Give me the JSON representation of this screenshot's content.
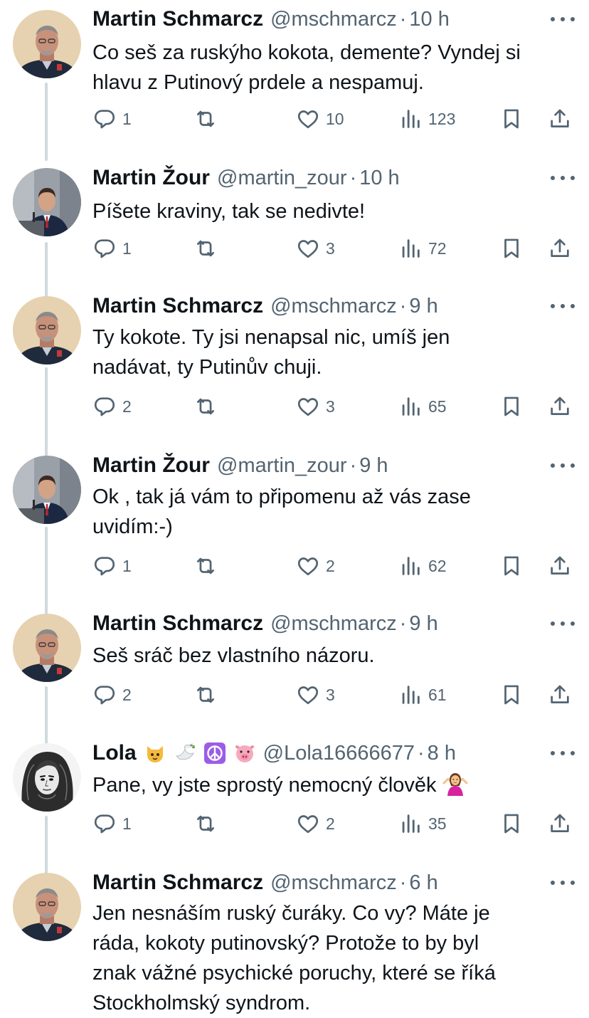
{
  "tweets": [
    {
      "name": "Martin Schmarcz",
      "handle": "@mschmarcz",
      "dot": "·",
      "time": "10 h",
      "lines": [
        "Co seš za ruskýho kokota, demente? Vyndej si",
        "hlavu z Putinový prdele a nespamuj."
      ],
      "replies": "1",
      "likes": "10",
      "views": "123",
      "avatar": "schmarcz"
    },
    {
      "name": "Martin Žour",
      "handle": "@martin_zour",
      "dot": "·",
      "time": "10 h",
      "lines": [
        "Píšete kraviny, tak se nedivte!"
      ],
      "replies": "1",
      "likes": "3",
      "views": "72",
      "avatar": "zour"
    },
    {
      "name": "Martin Schmarcz",
      "handle": "@mschmarcz",
      "dot": "·",
      "time": "9 h",
      "lines": [
        "Ty kokote. Ty jsi nenapsal nic, umíš jen",
        "nadávat, ty Putinův chuji."
      ],
      "replies": "2",
      "likes": "3",
      "views": "65",
      "avatar": "schmarcz"
    },
    {
      "name": "Martin Žour",
      "handle": "@martin_zour",
      "dot": "·",
      "time": "9 h",
      "lines": [
        "Ok , tak já vám to připomenu až vás zase",
        "uvidím:-)"
      ],
      "replies": "1",
      "likes": "2",
      "views": "62",
      "avatar": "zour"
    },
    {
      "name": "Martin Schmarcz",
      "handle": "@mschmarcz",
      "dot": "·",
      "time": "9 h",
      "lines": [
        "Seš sráč bez vlastního názoru."
      ],
      "replies": "2",
      "likes": "3",
      "views": "61",
      "avatar": "schmarcz"
    },
    {
      "name": "Lola",
      "handle": "@Lola16666677",
      "dot": "·",
      "time": "8 h",
      "lines": [
        "Pane, vy jste sprostý nemocný člověk"
      ],
      "replies": "1",
      "likes": "2",
      "views": "35",
      "avatar": "lola",
      "name_emojis": [
        "cat-face-emoji",
        "dove-emoji",
        "peace-symbol-emoji",
        "pig-face-emoji"
      ],
      "text_emoji": "person-shrugging-emoji"
    },
    {
      "name": "Martin Schmarcz",
      "handle": "@mschmarcz",
      "dot": "·",
      "time": "6 h",
      "lines": [
        "Jen nesnáším ruský čuráky. Co vy? Máte je",
        "ráda, kokoty putinovský? Protože to by byl",
        "znak vážné psychické poruchy, které se říká",
        "Stockholmský syndrom."
      ],
      "avatar": "schmarcz"
    }
  ],
  "icons": {
    "reply": "reply-icon",
    "retweet": "retweet-icon",
    "like": "like-icon",
    "views": "views-icon",
    "bookmark": "bookmark-icon",
    "share": "share-icon",
    "more": "more-options-icon"
  },
  "colors": {
    "text": "#0f1419",
    "secondary": "#536471",
    "thread_line": "#cfd9de",
    "background": "#ffffff"
  }
}
